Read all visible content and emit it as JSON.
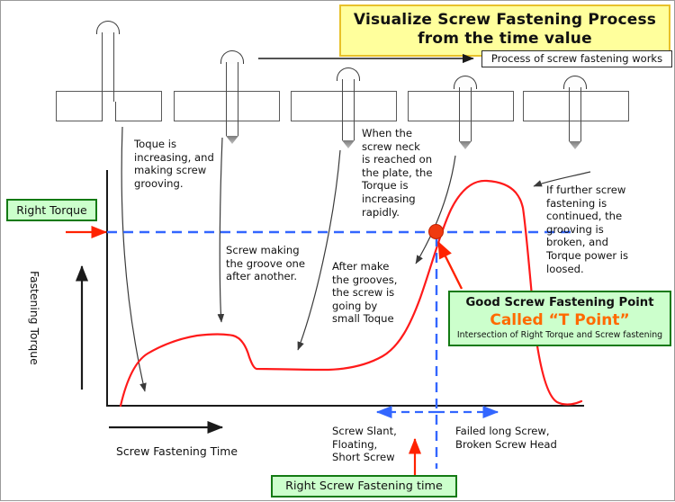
{
  "title": {
    "line1": "Visualize Screw Fastening  Process",
    "line2": "from the time value",
    "bg": "#FFFF9C",
    "border": "#E8C12A"
  },
  "process_caption": "Process of screw fastening works",
  "chart_data": {
    "type": "line",
    "title": "Visualize Screw Fastening Process from the time value",
    "xlabel": "Screw Fastening Time",
    "ylabel": "Fastening Torque",
    "grid": false,
    "legend": "none",
    "series": [
      {
        "name": "Fastening Torque",
        "color": "#FF1A1A",
        "x": [
          0.0,
          0.04,
          0.08,
          0.13,
          0.18,
          0.24,
          0.3,
          0.36,
          0.42,
          0.47,
          0.52,
          0.57,
          0.62,
          0.66,
          0.7,
          0.73,
          0.76,
          0.79,
          0.82,
          0.86,
          0.9,
          0.93,
          0.96,
          0.98,
          1.0
        ],
        "y": [
          0.0,
          0.1,
          0.2,
          0.28,
          0.33,
          0.35,
          0.34,
          0.28,
          0.22,
          0.21,
          0.21,
          0.21,
          0.22,
          0.26,
          0.4,
          0.58,
          0.72,
          0.83,
          0.92,
          0.95,
          0.94,
          0.6,
          0.2,
          0.06,
          0.03
        ]
      }
    ],
    "markers": [
      {
        "name": "T Point",
        "x": 0.675,
        "y": 0.625,
        "color": "#F03A10",
        "label": "Good Screw Fastening Point — Called “T Point”"
      }
    ],
    "reference_lines": [
      {
        "name": "Right Torque",
        "orientation": "horizontal",
        "value": 0.625,
        "color": "#3366FF",
        "style": "dashed"
      },
      {
        "name": "Right Screw Fastening time",
        "orientation": "vertical",
        "value": 0.675,
        "color": "#3366FF",
        "style": "dashed"
      }
    ],
    "xlim": [
      0,
      1
    ],
    "ylim": [
      0,
      1
    ]
  },
  "notes": {
    "n1": "Toque is\nincreasing, and\nmaking screw\ngrooving.",
    "n2": "Screw making\nthe groove one\nafter another.",
    "n3": "After make\nthe grooves,\nthe screw is\ngoing  by\nsmall  Toque",
    "n4": "When the\nscrew  neck\nis reached  on\nthe plate, the\nTorque is\nincreasing\nrapidly.",
    "n5": "If further screw\nfastening is\ncontinued, the\ngrooving is\nbroken, and\nTorque power is\nloosed.",
    "n6": "Screw Slant,\nFloating,\nShort Screw",
    "n7": "Failed long Screw,\nBroken Screw Head"
  },
  "labels": {
    "right_torque": "Right Torque",
    "right_time": "Right Screw Fastening time",
    "x_axis": "Screw Fastening Time",
    "y_axis": "Fastening Torque"
  },
  "tpoint": {
    "line1": "Good Screw Fastening Point",
    "line2": "Called “T Point”",
    "line3": "Intersection of Right Torque and Screw fastening",
    "bg": "#CCFFCC",
    "border": "#137A13",
    "accent": "#FF6A00"
  },
  "colors": {
    "curve": "#FF1A1A",
    "dashed": "#3366FF",
    "arrow_red": "#FF2200",
    "leader": "#3a3a3a",
    "plate": "#5a5a5a"
  }
}
